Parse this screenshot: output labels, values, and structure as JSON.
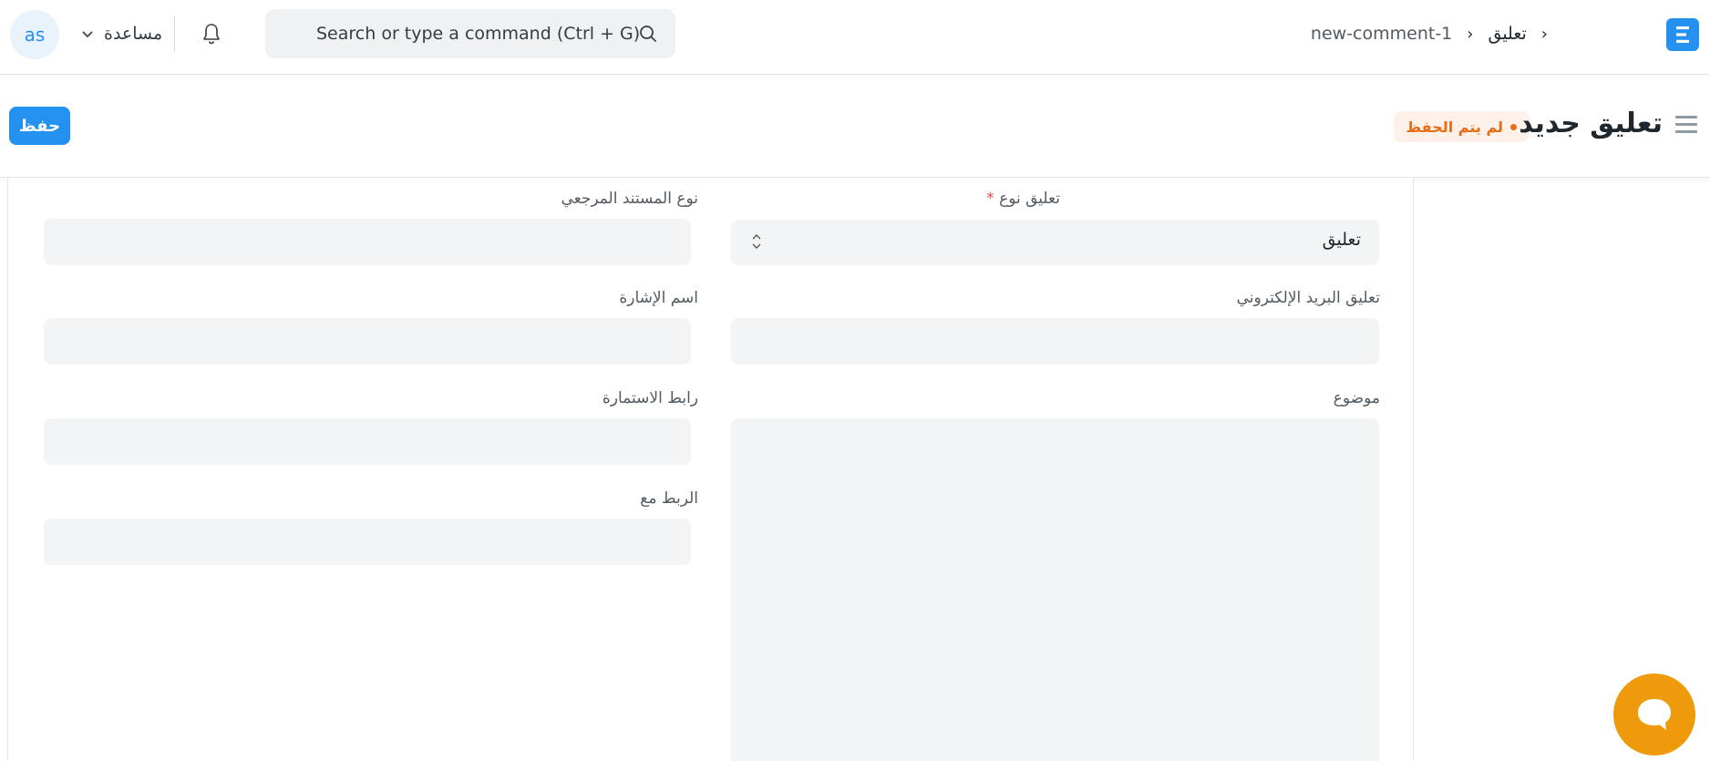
{
  "navbar": {
    "avatar_initials": "as",
    "help_label": "مساعدة",
    "search_placeholder": "Search or type a command (Ctrl + G)",
    "breadcrumb": [
      "تعليق",
      "new-comment-1"
    ],
    "logo_letter": "E"
  },
  "page_head": {
    "title": "تعليق جديد",
    "status": "لم يتم الحفظ",
    "save_label": "حفظ"
  },
  "form": {
    "comment_type": {
      "label": "تعليق نوع",
      "required_mark": "*",
      "value": "تعليق"
    },
    "comment_email": {
      "label": "تعليق البريد الإلكتروني",
      "value": ""
    },
    "subject": {
      "label": "موضوع",
      "value": ""
    },
    "reference_doctype": {
      "label": "نوع المستند المرجعي",
      "value": ""
    },
    "reference_name": {
      "label": "اسم الإشارة",
      "value": ""
    },
    "form_link": {
      "label": "رابط الاستمارة",
      "value": ""
    },
    "link_with": {
      "label": "الربط مع",
      "value": ""
    }
  },
  "colors": {
    "primary": "#2490ef",
    "status_orange": "#e86c13",
    "chat_orange": "#ef9a0b",
    "input_bg": "#f3f4f6"
  },
  "icons": [
    "chevron-down-icon",
    "bell-icon",
    "search-icon",
    "app-logo-icon",
    "menu-icon",
    "select-arrows-icon",
    "chat-icon"
  ]
}
